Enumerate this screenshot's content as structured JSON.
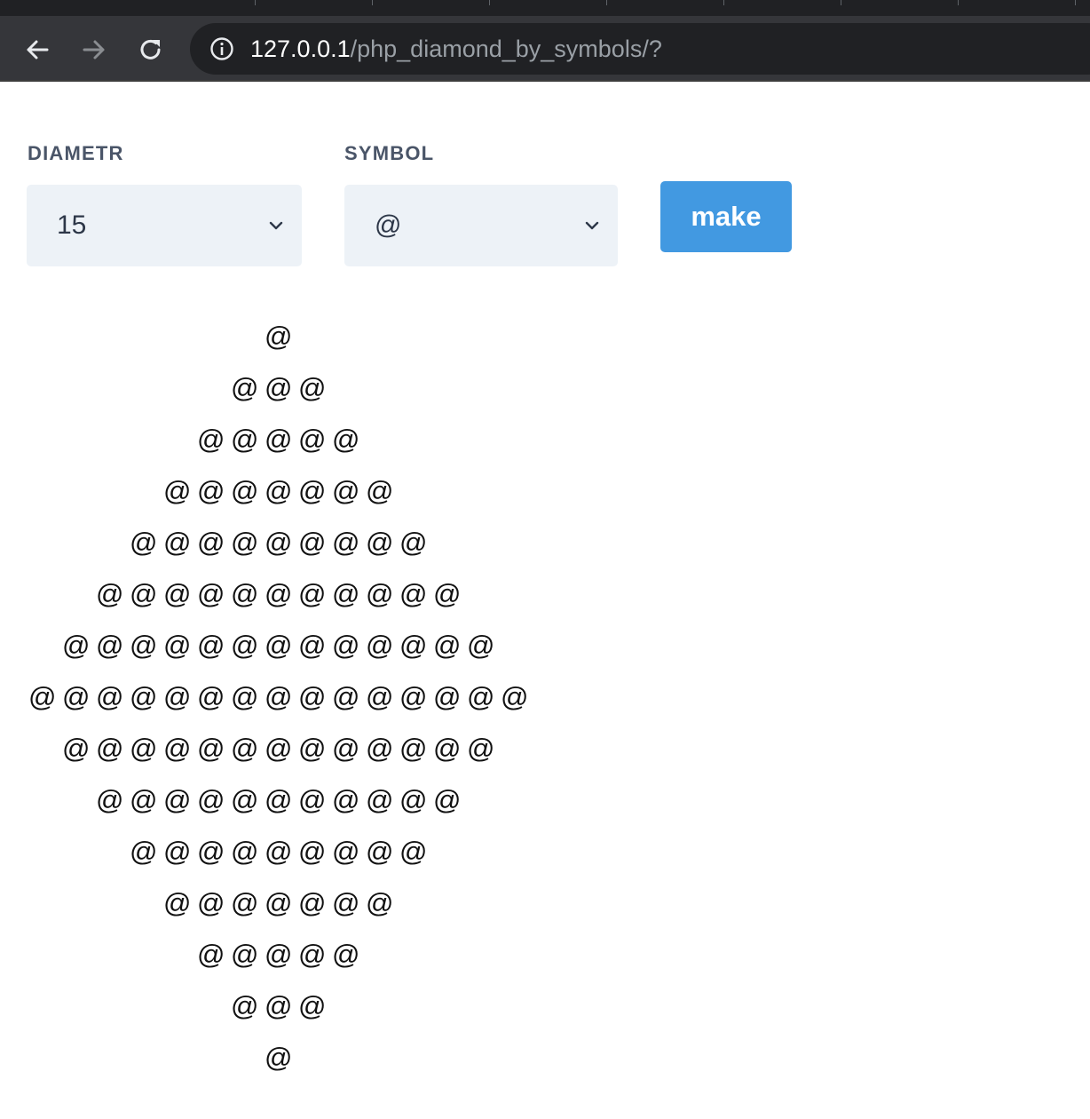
{
  "browser": {
    "url_host": "127.0.0.1",
    "url_path": "/php_diamond_by_symbols/?"
  },
  "form": {
    "diametr_label": "DIAMETR",
    "diametr_value": "15",
    "symbol_label": "SYMBOL",
    "symbol_value": "@",
    "make_label": "make"
  },
  "diamond": {
    "symbol": "@",
    "row_counts": [
      1,
      3,
      5,
      7,
      9,
      11,
      13,
      15,
      13,
      11,
      9,
      7,
      5,
      3,
      1
    ]
  }
}
